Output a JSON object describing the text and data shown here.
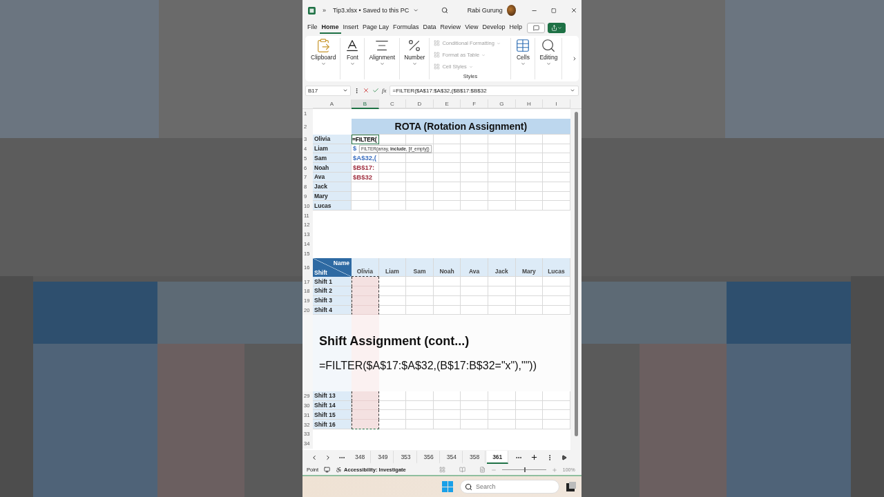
{
  "title_bar": {
    "overflow": "»",
    "file": "Tip3.xlsx • Saved to this PC",
    "user": "Rabi Gurung"
  },
  "menu_tabs": [
    {
      "label": "File",
      "selected": false
    },
    {
      "label": "Home",
      "selected": true
    },
    {
      "label": "Insert",
      "selected": false
    },
    {
      "label": "Page Lay",
      "selected": false
    },
    {
      "label": "Formulas",
      "selected": false
    },
    {
      "label": "Data",
      "selected": false
    },
    {
      "label": "Review",
      "selected": false
    },
    {
      "label": "View",
      "selected": false
    },
    {
      "label": "Develop",
      "selected": false
    },
    {
      "label": "Help",
      "selected": false
    }
  ],
  "ribbon": {
    "groups": [
      {
        "kind": "clipboard",
        "label": "Clipboard"
      },
      {
        "kind": "font",
        "label": "Font"
      },
      {
        "kind": "alignment",
        "label": "Alignment"
      },
      {
        "kind": "number",
        "label": "Number"
      },
      {
        "kind": "styles",
        "label": "Styles",
        "items": [
          {
            "label": "Conditional Formatting",
            "disabled": true
          },
          {
            "label": "Format as Table",
            "disabled": true
          },
          {
            "label": "Cell Styles",
            "disabled": true
          }
        ]
      },
      {
        "kind": "cells",
        "label": "Cells"
      },
      {
        "kind": "editing",
        "label": "Editing"
      }
    ]
  },
  "formula_bar": {
    "name_box": "B17",
    "fx_label": "fx",
    "formula": "=FILTER($A$17:$A$32,($B$17:$B$32"
  },
  "columns": [
    {
      "label": "A",
      "selected": false
    },
    {
      "label": "B",
      "selected": true
    },
    {
      "label": "C",
      "selected": false
    },
    {
      "label": "D",
      "selected": false
    },
    {
      "label": "E",
      "selected": false
    },
    {
      "label": "F",
      "selected": false
    },
    {
      "label": "G",
      "selected": false
    },
    {
      "label": "H",
      "selected": false
    },
    {
      "label": "I",
      "selected": false
    }
  ],
  "rows": [
    {
      "number": "1",
      "kind": "blank"
    },
    {
      "number": "2",
      "kind": "title",
      "title": "ROTA (Rotation Assignment)"
    },
    {
      "number": "3",
      "kind": "name",
      "label": "Olivia",
      "value": "=FILTER(",
      "color": "#000000",
      "editing": true
    },
    {
      "number": "4",
      "kind": "name",
      "label": "Liam",
      "value": "$",
      "color": "#3c6fc0",
      "editing": false,
      "tooltip": "FILTER(array, **include**, [if_empty])"
    },
    {
      "number": "5",
      "kind": "name",
      "label": "Sam",
      "value": "$A$32,(",
      "color": "#3c6fc0",
      "editing": false
    },
    {
      "number": "6",
      "kind": "name",
      "label": "Noah",
      "value": "$B$17:",
      "color": "#a03040",
      "editing": false
    },
    {
      "number": "7",
      "kind": "name",
      "label": "Ava",
      "value": "$B$32",
      "color": "#a03040",
      "editing": false
    },
    {
      "number": "8",
      "kind": "name",
      "label": "Jack",
      "editing": false
    },
    {
      "number": "9",
      "kind": "name",
      "label": "Mary",
      "editing": false
    },
    {
      "number": "10",
      "kind": "name",
      "label": "Lucas",
      "editing": false
    },
    {
      "number": "11",
      "kind": "blank"
    },
    {
      "number": "12",
      "kind": "blank"
    },
    {
      "number": "13",
      "kind": "blank"
    },
    {
      "number": "14",
      "kind": "blank"
    },
    {
      "number": "15",
      "kind": "blank"
    },
    {
      "number": "16",
      "kind": "header",
      "corner_top": "Name",
      "corner_bottom": "Shift",
      "names": [
        "Olivia",
        "Liam",
        "Sam",
        "Noah",
        "Ava",
        "Jack",
        "Mary",
        "Lucas"
      ]
    },
    {
      "number": "17",
      "kind": "shift",
      "label": "Shift 1"
    },
    {
      "number": "18",
      "kind": "shift",
      "label": "Shift 2"
    },
    {
      "number": "19",
      "kind": "shift",
      "label": "Shift 3"
    },
    {
      "number": "20",
      "kind": "shift",
      "label": "Shift 4"
    },
    {
      "kind": "caption",
      "heading": "Shift Assignment (cont...)",
      "formula": "=FILTER($A$17:$A$32,(B$17:B$32=\"x\"),\"\"))"
    },
    {
      "number": "29",
      "kind": "shift",
      "label": "Shift 13"
    },
    {
      "number": "30",
      "kind": "shift",
      "label": "Shift 14"
    },
    {
      "number": "31",
      "kind": "shift",
      "label": "Shift 15"
    },
    {
      "number": "32",
      "kind": "shift",
      "label": "Shift 16"
    },
    {
      "number": "33",
      "kind": "blank"
    },
    {
      "number": "34",
      "kind": "blank"
    }
  ],
  "sheet_tabs": [
    {
      "label": "348",
      "selected": false
    },
    {
      "label": "349",
      "selected": false
    },
    {
      "label": "353",
      "selected": false
    },
    {
      "label": "356",
      "selected": false
    },
    {
      "label": "354",
      "selected": false
    },
    {
      "label": "358",
      "selected": false
    },
    {
      "label": "361",
      "selected": true
    }
  ],
  "status_bar": {
    "mode": "Point",
    "accessibility": "Accessibility: Investigate",
    "zoom": {
      "level": 0.5,
      "reading": "100%"
    }
  },
  "taskbar": {
    "search": {
      "placeholder": "Search"
    }
  }
}
